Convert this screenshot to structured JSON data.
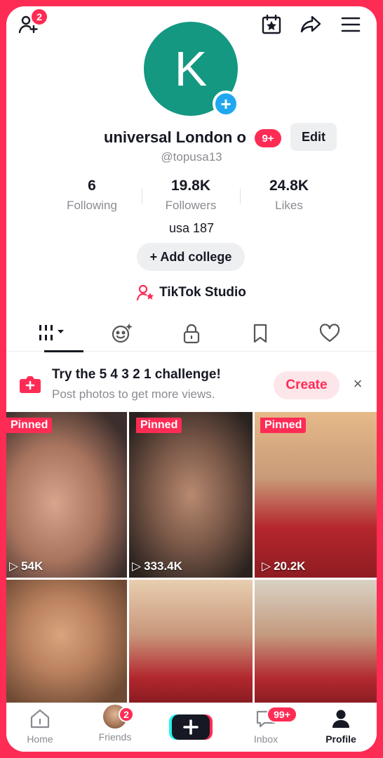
{
  "header": {
    "add_friends_badge": "2",
    "icons": [
      "add-friends-icon",
      "calendar-star-icon",
      "share-icon",
      "menu-icon"
    ]
  },
  "profile": {
    "avatar_letter": "K",
    "display_name": "universal London o",
    "notification_badge": "9+",
    "edit_label": "Edit",
    "username": "@topusa13",
    "stats": [
      {
        "value": "6",
        "label": "Following"
      },
      {
        "value": "19.8K",
        "label": "Followers"
      },
      {
        "value": "24.8K",
        "label": "Likes"
      }
    ],
    "bio": "usa 187",
    "add_college_label": "+ Add college",
    "studio_label": "TikTok Studio"
  },
  "tabs": [
    "videos-grid-icon",
    "reposts-icon",
    "private-lock-icon",
    "saved-bookmark-icon",
    "liked-heart-icon"
  ],
  "challenge": {
    "title": "Try the 5 4 3 2 1 challenge!",
    "subtitle": "Post photos to get more views.",
    "create_label": "Create",
    "close_glyph": "×"
  },
  "videos": [
    {
      "pinned": "Pinned",
      "views": "54K"
    },
    {
      "pinned": "Pinned",
      "views": "333.4K"
    },
    {
      "pinned": "Pinned",
      "views": "20.2K"
    },
    {
      "pinned": "",
      "views": ""
    },
    {
      "pinned": "",
      "views": ""
    },
    {
      "pinned": "",
      "views": ""
    }
  ],
  "bottom_nav": {
    "home": "Home",
    "friends": "Friends",
    "friends_badge": "2",
    "inbox": "Inbox",
    "inbox_badge": "99+",
    "profile": "Profile"
  },
  "colors": {
    "accent": "#fe2c55",
    "avatar": "#149882",
    "plus": "#1fa8f0"
  }
}
